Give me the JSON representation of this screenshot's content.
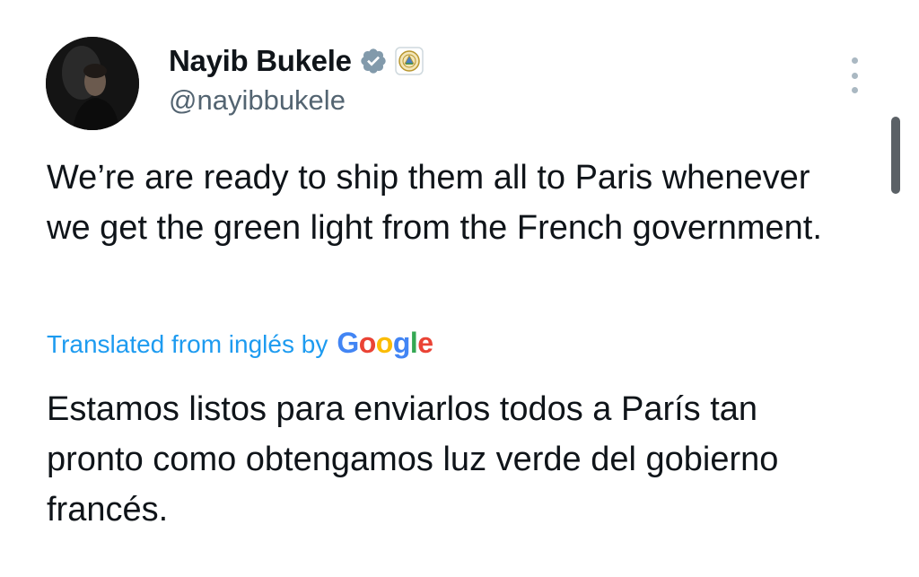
{
  "author": {
    "display_name": "Nayib Bukele",
    "handle": "@nayibbukele",
    "verified_badge": "verified-check-icon",
    "affiliate_badge": "el-salvador-seal-icon"
  },
  "menu": {
    "more_icon": "vertical-ellipsis-icon"
  },
  "tweet": {
    "text": "We’re are ready to ship them all to Paris whenever we get the green light from the French government."
  },
  "translation": {
    "label": "Translated from inglés by",
    "provider_letters": [
      "G",
      "o",
      "o",
      "g",
      "l",
      "e"
    ],
    "provider_colors": [
      "#4285f4",
      "#ea4335",
      "#fbbc05",
      "#4285f4",
      "#34a853",
      "#ea4335"
    ],
    "text": "Estamos listos para enviarlos todos a París tan pronto como obtengamos luz verde del gobierno francés."
  },
  "colors": {
    "link": "#1d9bf0",
    "secondary_text": "#536471",
    "verified": "#829aab"
  }
}
